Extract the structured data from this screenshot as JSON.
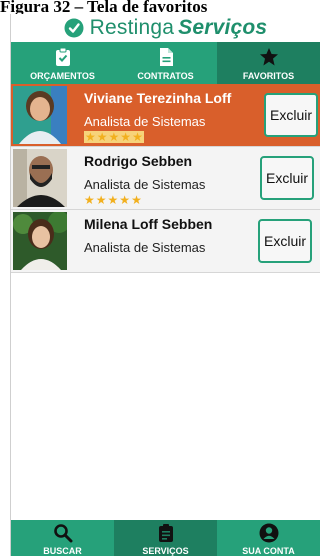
{
  "document": {
    "caption": "Figura 32 – Tela de favoritos"
  },
  "header": {
    "brand_regular": "Restinga",
    "brand_bold": "Serviços"
  },
  "top_tabs": [
    {
      "label": "ORÇAMENTOS",
      "icon": "clipboard-check-icon"
    },
    {
      "label": "CONTRATOS",
      "icon": "document-icon"
    },
    {
      "label": "FAVORITOS",
      "icon": "star-icon"
    }
  ],
  "favorites": [
    {
      "name": "Viviane Terezinha Loff",
      "role": "Analista de Sistemas",
      "rating": 5,
      "highlighted": true,
      "button_label": "Excluir"
    },
    {
      "name": "Rodrigo Sebben",
      "role": "Analista de Sistemas",
      "rating": 5,
      "highlighted": false,
      "button_label": "Excluir"
    },
    {
      "name": "Milena Loff Sebben",
      "role": "Analista de Sistemas",
      "rating": 0,
      "highlighted": false,
      "button_label": "Excluir"
    }
  ],
  "bottom_nav": [
    {
      "label": "BUSCAR",
      "icon": "search-icon"
    },
    {
      "label": "SERVIÇOS",
      "icon": "clipboard-icon"
    },
    {
      "label": "SUA CONTA",
      "icon": "user-icon"
    }
  ],
  "colors": {
    "accent": "#26a17a",
    "accent_dark": "#1e7f60",
    "highlight": "#d95f2b",
    "star": "#f2b01e"
  }
}
